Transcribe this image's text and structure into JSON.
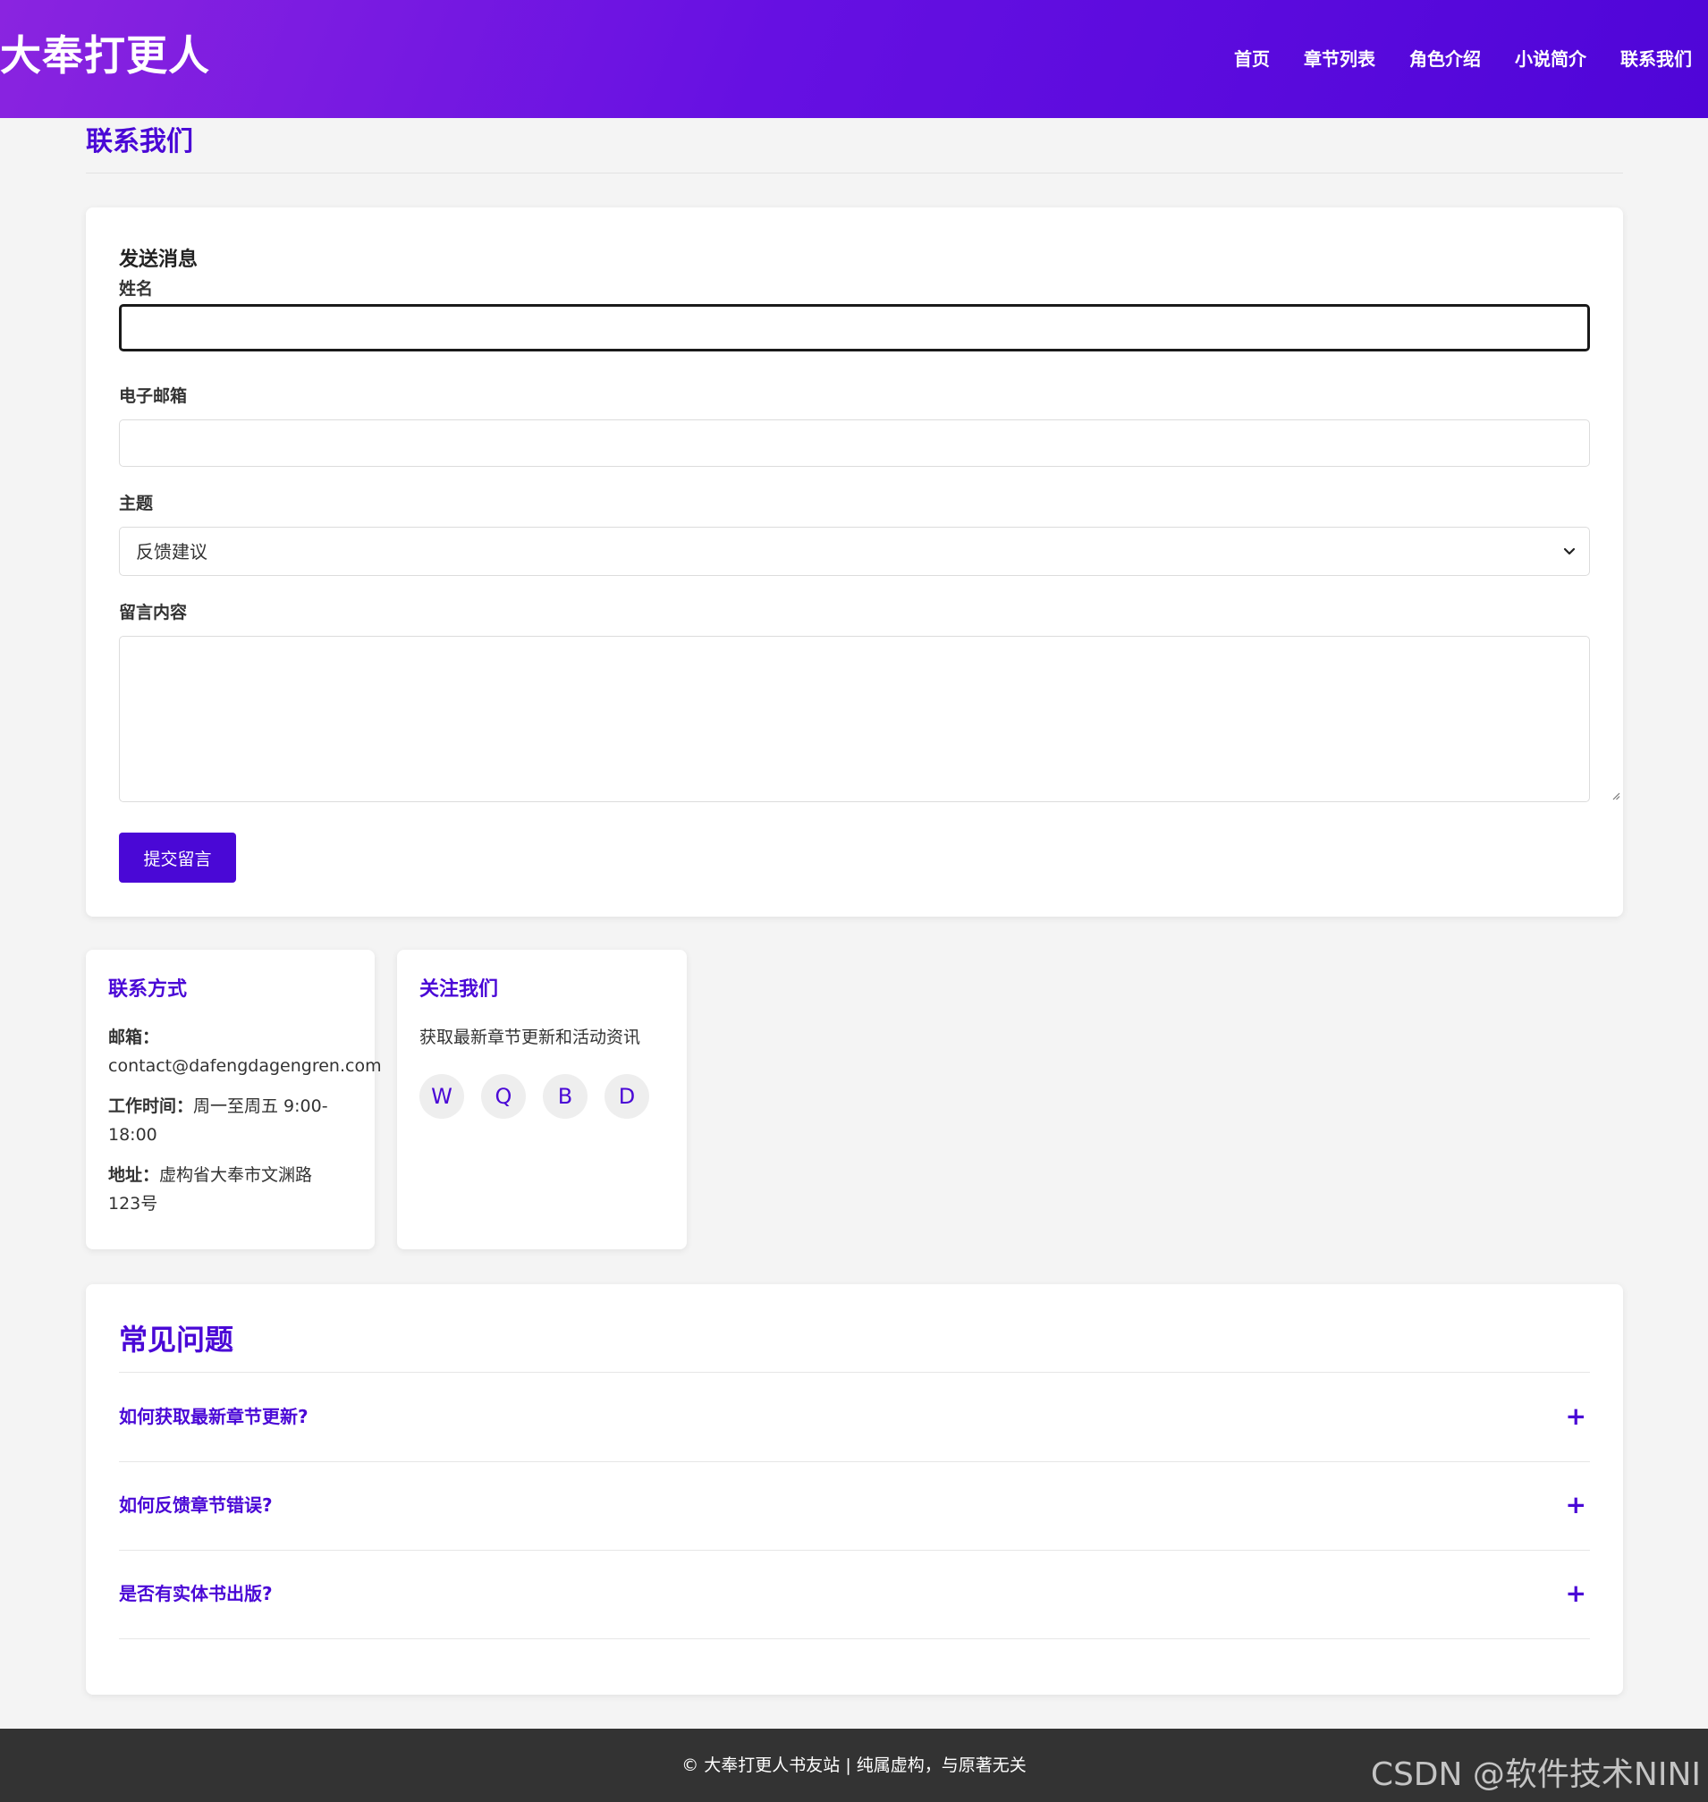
{
  "site": {
    "logo": "大奉打更人"
  },
  "nav": {
    "items": [
      {
        "label": "首页"
      },
      {
        "label": "章节列表"
      },
      {
        "label": "角色介绍"
      },
      {
        "label": "小说简介"
      },
      {
        "label": "联系我们"
      }
    ]
  },
  "page": {
    "title": "联系我们"
  },
  "form": {
    "heading": "发送消息",
    "name_label": "姓名",
    "name_value": "",
    "email_label": "电子邮箱",
    "email_value": "",
    "subject_label": "主题",
    "subject_value": "反馈建议",
    "message_label": "留言内容",
    "message_value": "",
    "submit_label": "提交留言",
    "accent_color": "#4a08d6"
  },
  "contact": {
    "title": "联系方式",
    "email_key": "邮箱：",
    "email_value": "contact@dafengdagengren.com",
    "hours_key": "工作时间：",
    "hours_value_line1": "周一至周五 9:00-",
    "hours_value_line2": "18:00",
    "address_key": "地址：",
    "address_value_line1": "虚构省大奉市文渊路",
    "address_value_line2": "123号"
  },
  "follow": {
    "title": "关注我们",
    "description": "获取最新章节更新和活动资讯",
    "social": [
      {
        "label": "W",
        "icon": "w-social-icon"
      },
      {
        "label": "Q",
        "icon": "q-social-icon"
      },
      {
        "label": "B",
        "icon": "b-social-icon"
      },
      {
        "label": "D",
        "icon": "d-social-icon"
      }
    ]
  },
  "faq": {
    "title": "常见问题",
    "items": [
      {
        "question": "如何获取最新章节更新?",
        "toggle": "+"
      },
      {
        "question": "如何反馈章节错误?",
        "toggle": "+"
      },
      {
        "question": "是否有实体书出版?",
        "toggle": "+"
      }
    ]
  },
  "footer": {
    "text": "© 大奉打更人书友站 | 纯属虚构，与原著无关",
    "watermark": "CSDN @软件技术NINI"
  }
}
